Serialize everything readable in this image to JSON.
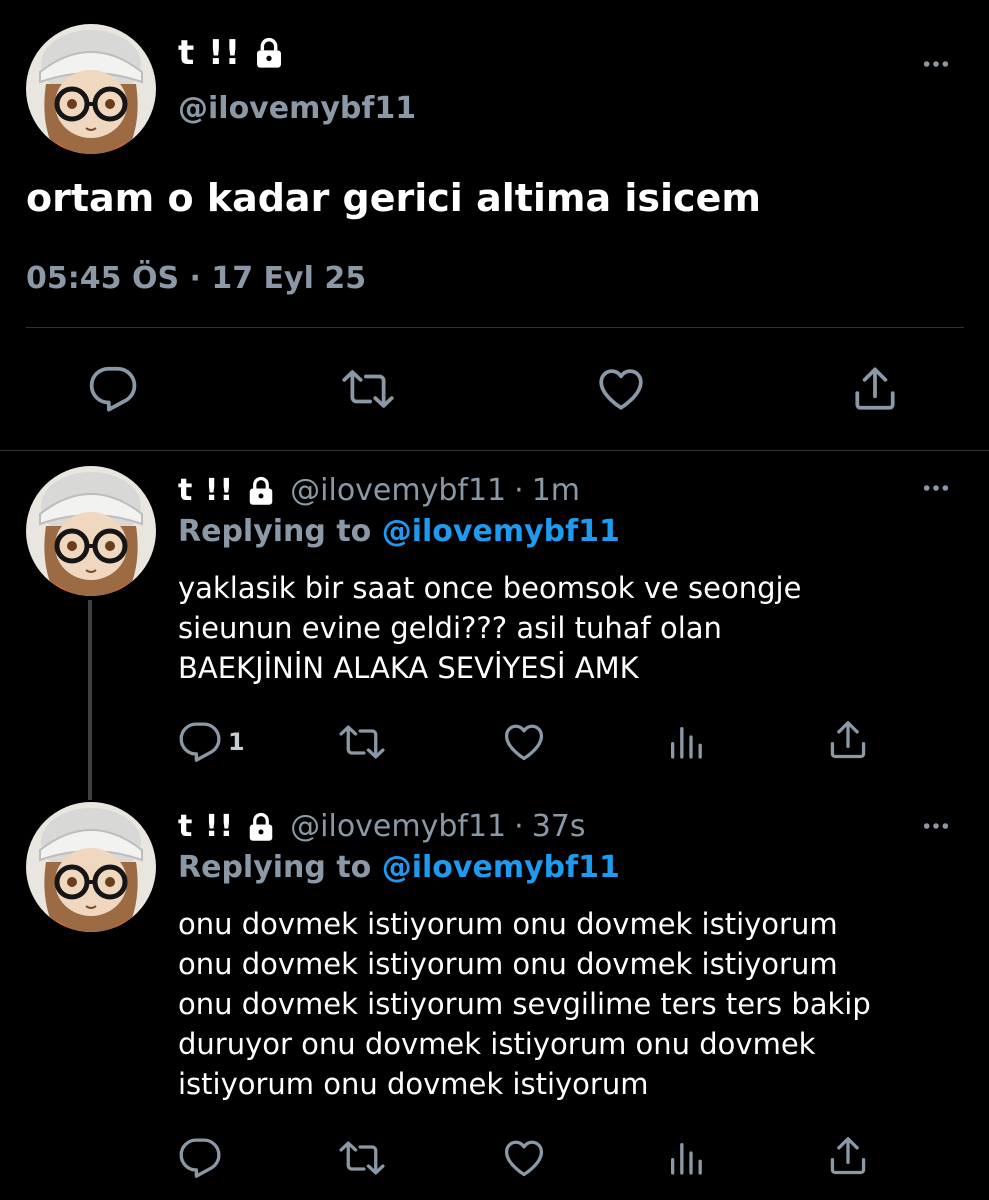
{
  "main_tweet": {
    "name": "t !!",
    "handle": "@ilovemybf11",
    "text": "ortam o kadar gerici altima isicem",
    "time": "05:45 ÖS",
    "separator": "·",
    "date": "17 Eyl 25",
    "more_icon": "more-horizontal-icon",
    "actions": [
      "reply-icon",
      "retweet-icon",
      "like-icon",
      "share-icon"
    ]
  },
  "replies": [
    {
      "name": "t !!",
      "handle": "@ilovemybf11",
      "separator": "·",
      "time": "1m",
      "replying_label": "Replying to",
      "replying_to": "@ilovemybf11",
      "text": "yaklasik bir saat once beomsok ve seongje\nsieunun evine geldi??? asil tuhaf olan\nBAEKJİNİN ALAKA SEVİYESİ AMK",
      "reply_count": "1"
    },
    {
      "name": "t !!",
      "handle": "@ilovemybf11",
      "separator": "·",
      "time": "37s",
      "replying_label": "Replying to",
      "replying_to": "@ilovemybf11",
      "text": "onu dovmek istiyorum onu dovmek istiyorum\nonu dovmek istiyorum onu dovmek istiyorum\nonu dovmek istiyorum sevgilime ters ters bakip\nduruyor onu dovmek istiyorum onu dovmek\nistiyorum onu dovmek istiyorum",
      "reply_count": ""
    }
  ],
  "colors": {
    "background": "#000000",
    "secondary_text": "#8b98a5",
    "mention": "#1d9bf0",
    "divider": "#2f3336"
  }
}
